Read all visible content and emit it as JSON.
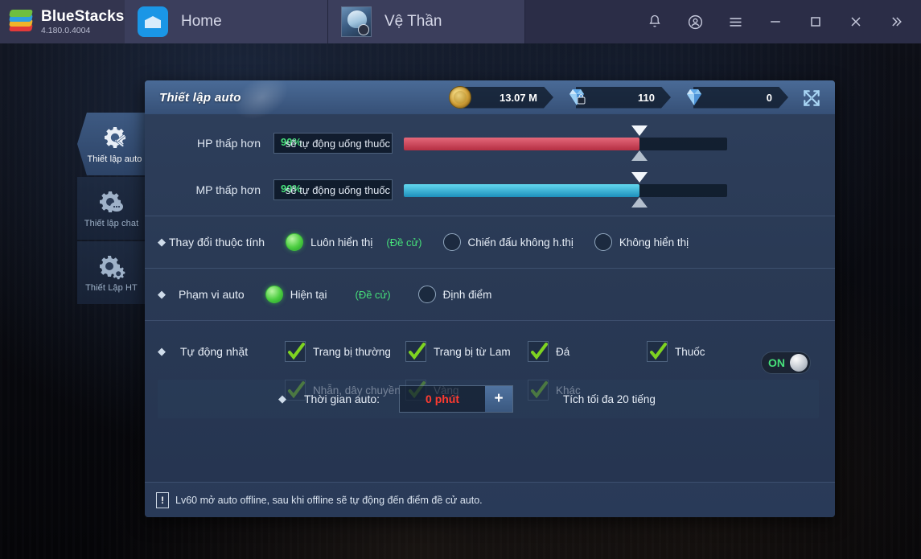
{
  "titlebar": {
    "brand_name": "BlueStacks",
    "version": "4.180.0.4004",
    "tabs": [
      {
        "label": "Home",
        "icon": "home-icon"
      },
      {
        "label": "Vệ Thần",
        "icon": "game-avatar-icon"
      }
    ],
    "buttons": [
      {
        "name": "notifications-icon",
        "label": ""
      },
      {
        "name": "account-icon",
        "label": ""
      },
      {
        "name": "menu-icon",
        "label": ""
      },
      {
        "name": "minimize-icon",
        "label": ""
      },
      {
        "name": "maximize-icon",
        "label": ""
      },
      {
        "name": "close-icon",
        "label": ""
      },
      {
        "name": "more-icon",
        "label": ""
      }
    ]
  },
  "sidetabs": [
    {
      "label": "Thiết lập auto",
      "active": true
    },
    {
      "label": "Thiết lập chat",
      "active": false
    },
    {
      "label": "Thiết Lập HT",
      "active": false
    }
  ],
  "dialog": {
    "title": "Thiết lập auto",
    "resources": [
      {
        "name": "gold",
        "value": "13.07 M"
      },
      {
        "name": "bound-diamond",
        "value": "110"
      },
      {
        "name": "diamond",
        "value": "0"
      }
    ],
    "expand_icon": "expand-arrows-icon",
    "sliders": [
      {
        "label": "HP thấp hơn",
        "threshold": "90%",
        "hint": "sẽ tự động uống thuốc",
        "fill_percent": 73,
        "color": "#b52e42"
      },
      {
        "label": "MP thấp hơn",
        "threshold": "90%",
        "hint": "sẽ tự động uống thuốc",
        "fill_percent": 73,
        "color": "#1d8fbb"
      }
    ],
    "option_rows": [
      {
        "title": "Thay đổi thuộc tính",
        "options": [
          {
            "label": "Luôn hiển thị",
            "selected": true,
            "recommended": "(Đề cử)"
          },
          {
            "label": "Chiến đấu không h.thị",
            "selected": false,
            "recommended": ""
          },
          {
            "label": "Không hiển thị",
            "selected": false,
            "recommended": ""
          }
        ]
      },
      {
        "title": "Phạm vi auto",
        "options": [
          {
            "label": "Hiện tại",
            "selected": true,
            "recommended": "(Đề cử)"
          },
          {
            "label": "Định điểm",
            "selected": false,
            "recommended": ""
          }
        ]
      }
    ],
    "autopick": {
      "title": "Tự động nhặt",
      "row1": [
        {
          "label": "Trang bị thường",
          "checked": true
        },
        {
          "label": "Trang bị từ Lam",
          "checked": true
        },
        {
          "label": "Đá",
          "checked": true
        },
        {
          "label": "Thuốc",
          "checked": true
        }
      ],
      "row2": [
        {
          "label": "Nhẫn, dây chuyền",
          "checked": true
        },
        {
          "label": "Vàng",
          "checked": true
        },
        {
          "label": "Khác",
          "checked": true
        }
      ],
      "toggle_label": "ON",
      "toggle_state": true
    },
    "time_row": {
      "label": "Thời gian auto:",
      "value": "0 phút",
      "plus_label": "+",
      "note": "Tích tối đa 20 tiếng"
    },
    "footer_note": "Lv60 mở auto offline, sau khi offline sẽ tự động đến điểm đề cử auto.",
    "footer_icon": "exclamation-icon"
  },
  "colors": {
    "accent_green": "#46e07a",
    "hp_bar": "#b52e42",
    "mp_bar": "#1d8fbb",
    "value_red": "#ff3b30",
    "header_blue": "#3f5c85"
  }
}
